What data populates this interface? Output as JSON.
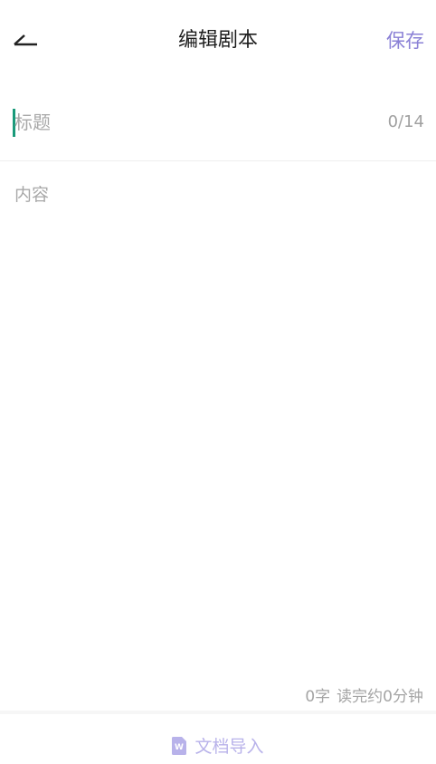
{
  "header": {
    "title": "编辑剧本",
    "save_label": "保存"
  },
  "title_field": {
    "placeholder": "标题",
    "value": "",
    "counter": "0/14"
  },
  "content_field": {
    "placeholder": "内容",
    "value": ""
  },
  "stats": {
    "word_count": "0字",
    "read_time": "读完约0分钟"
  },
  "footer": {
    "import_label": "文档导入",
    "import_icon": "word-document-icon"
  },
  "colors": {
    "accent": "#8a80d6",
    "accent_light": "#b8b2ea",
    "caret": "#1a9a7a"
  }
}
